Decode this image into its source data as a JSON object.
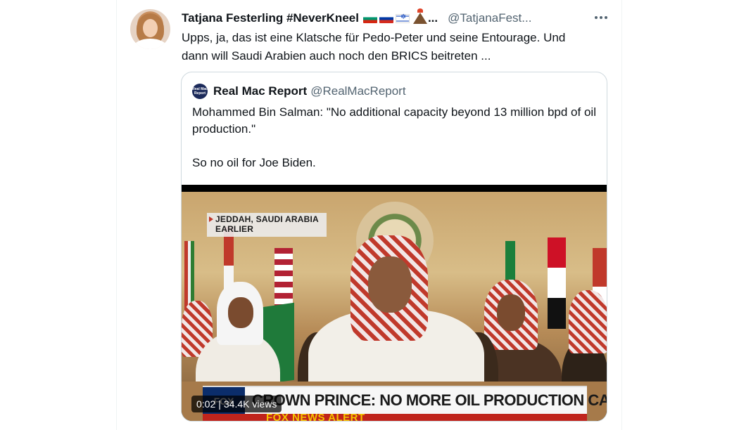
{
  "tweet": {
    "display_name": "Tatjana Festerling #NeverKneel",
    "name_suffix": "...",
    "handle": "@TatjanaFest...",
    "text_line1": "Upps, ja, das ist eine Klatsche für Pedo-Peter und seine Entourage. Und",
    "text_line2": "dann will Saudi Arabien auch noch den BRICS beitreten ..."
  },
  "quote": {
    "avatar_text": "Real Mac Report",
    "name": "Real Mac Report",
    "handle": "@RealMacReport",
    "text_p1": "Mohammed Bin Salman: \"No additional capacity beyond 13 million bpd of oil production.\"",
    "text_p2": "So no oil for Joe Biden."
  },
  "video": {
    "location_line1": "JEDDAH, SAUDI ARABIA",
    "location_line2": "EARLIER",
    "chyron_logo": "FOX",
    "chyron_text": "CROWN PRINCE: NO MORE OIL PRODUCTION CAPACITY",
    "alert_text": "FOX NEWS ALERT",
    "time": "0:02",
    "views": "34.4K views"
  },
  "icons": {
    "more": "more-horizontal-icon",
    "flags": [
      "bulgaria-flag-icon",
      "russia-flag-icon",
      "israel-flag-icon",
      "volcano-icon"
    ]
  }
}
